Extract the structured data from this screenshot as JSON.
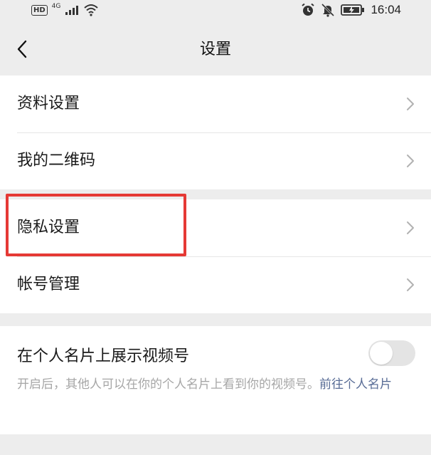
{
  "status_bar": {
    "network_badge": "HD",
    "network_type": "4G",
    "time": "16:04"
  },
  "nav": {
    "title": "设置",
    "back_icon": "chevron-left-icon"
  },
  "groups": [
    {
      "items": [
        {
          "label": "资料设置"
        },
        {
          "label": "我的二维码"
        }
      ]
    },
    {
      "items": [
        {
          "label": "隐私设置",
          "highlighted": true
        },
        {
          "label": "帐号管理"
        }
      ]
    }
  ],
  "toggle": {
    "label": "在个人名片上展示视频号",
    "enabled": false,
    "description": "开启后，其他人可以在你的个人名片上看到你的视频号。",
    "link_text": "前往个人名片"
  },
  "colors": {
    "background": "#ededed",
    "card": "#ffffff",
    "highlight": "#e53935",
    "link": "#576b95",
    "muted_text": "#a6a6a6"
  }
}
